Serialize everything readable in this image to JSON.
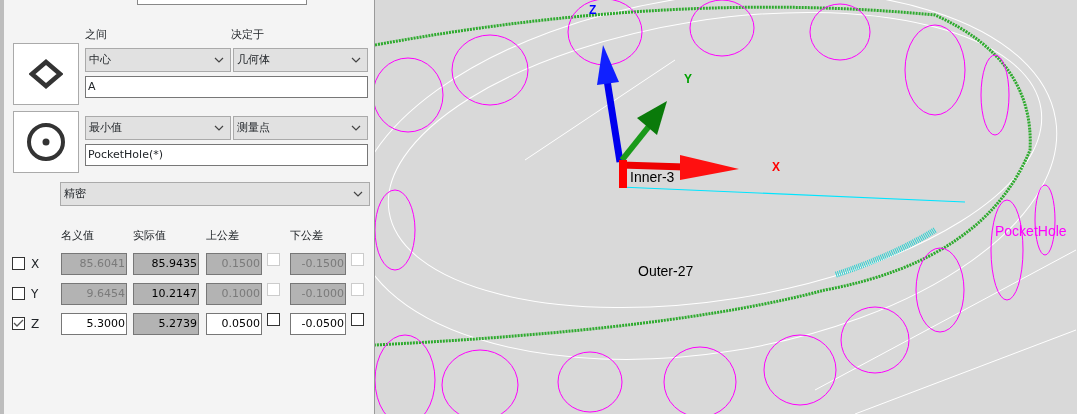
{
  "panel": {
    "headings": [
      "之间",
      "决定于"
    ],
    "features": [
      {
        "selects": [
          "中心",
          "几何体"
        ],
        "value": "A"
      },
      {
        "selects": [
          "最小值",
          "测量点"
        ],
        "value": "PocketHole(*)"
      }
    ],
    "mode_select": "精密",
    "table": {
      "columns": [
        "名义值",
        "实际值",
        "上公差",
        "下公差"
      ],
      "rows": [
        {
          "axis": "X",
          "checked": false,
          "nominal": "85.6041",
          "actual": "85.9435",
          "upper": "0.1500",
          "upper_checked": false,
          "lower": "-0.1500",
          "lower_checked": false
        },
        {
          "axis": "Y",
          "checked": false,
          "nominal": "9.6454",
          "actual": "10.2147",
          "upper": "0.1000",
          "upper_checked": false,
          "lower": "-0.1000",
          "lower_checked": false
        },
        {
          "axis": "Z",
          "checked": true,
          "nominal": "5.3000",
          "actual": "5.2739",
          "upper": "0.0500",
          "upper_checked": false,
          "lower": "-0.0500",
          "lower_checked": false
        }
      ]
    }
  },
  "viewport": {
    "labels": [
      {
        "kind": "axis",
        "text": "Z",
        "color": "#0000ff"
      },
      {
        "kind": "axis",
        "text": "Y",
        "color": "#00a000"
      },
      {
        "kind": "axis",
        "text": "X",
        "color": "#ff0000"
      },
      {
        "kind": "feature",
        "text": "Inner-3",
        "color": "#000000"
      },
      {
        "kind": "feature",
        "text": "Outer-27",
        "color": "#000000"
      },
      {
        "kind": "feature",
        "text": "PocketHole",
        "color": "#ff00ff"
      }
    ]
  }
}
